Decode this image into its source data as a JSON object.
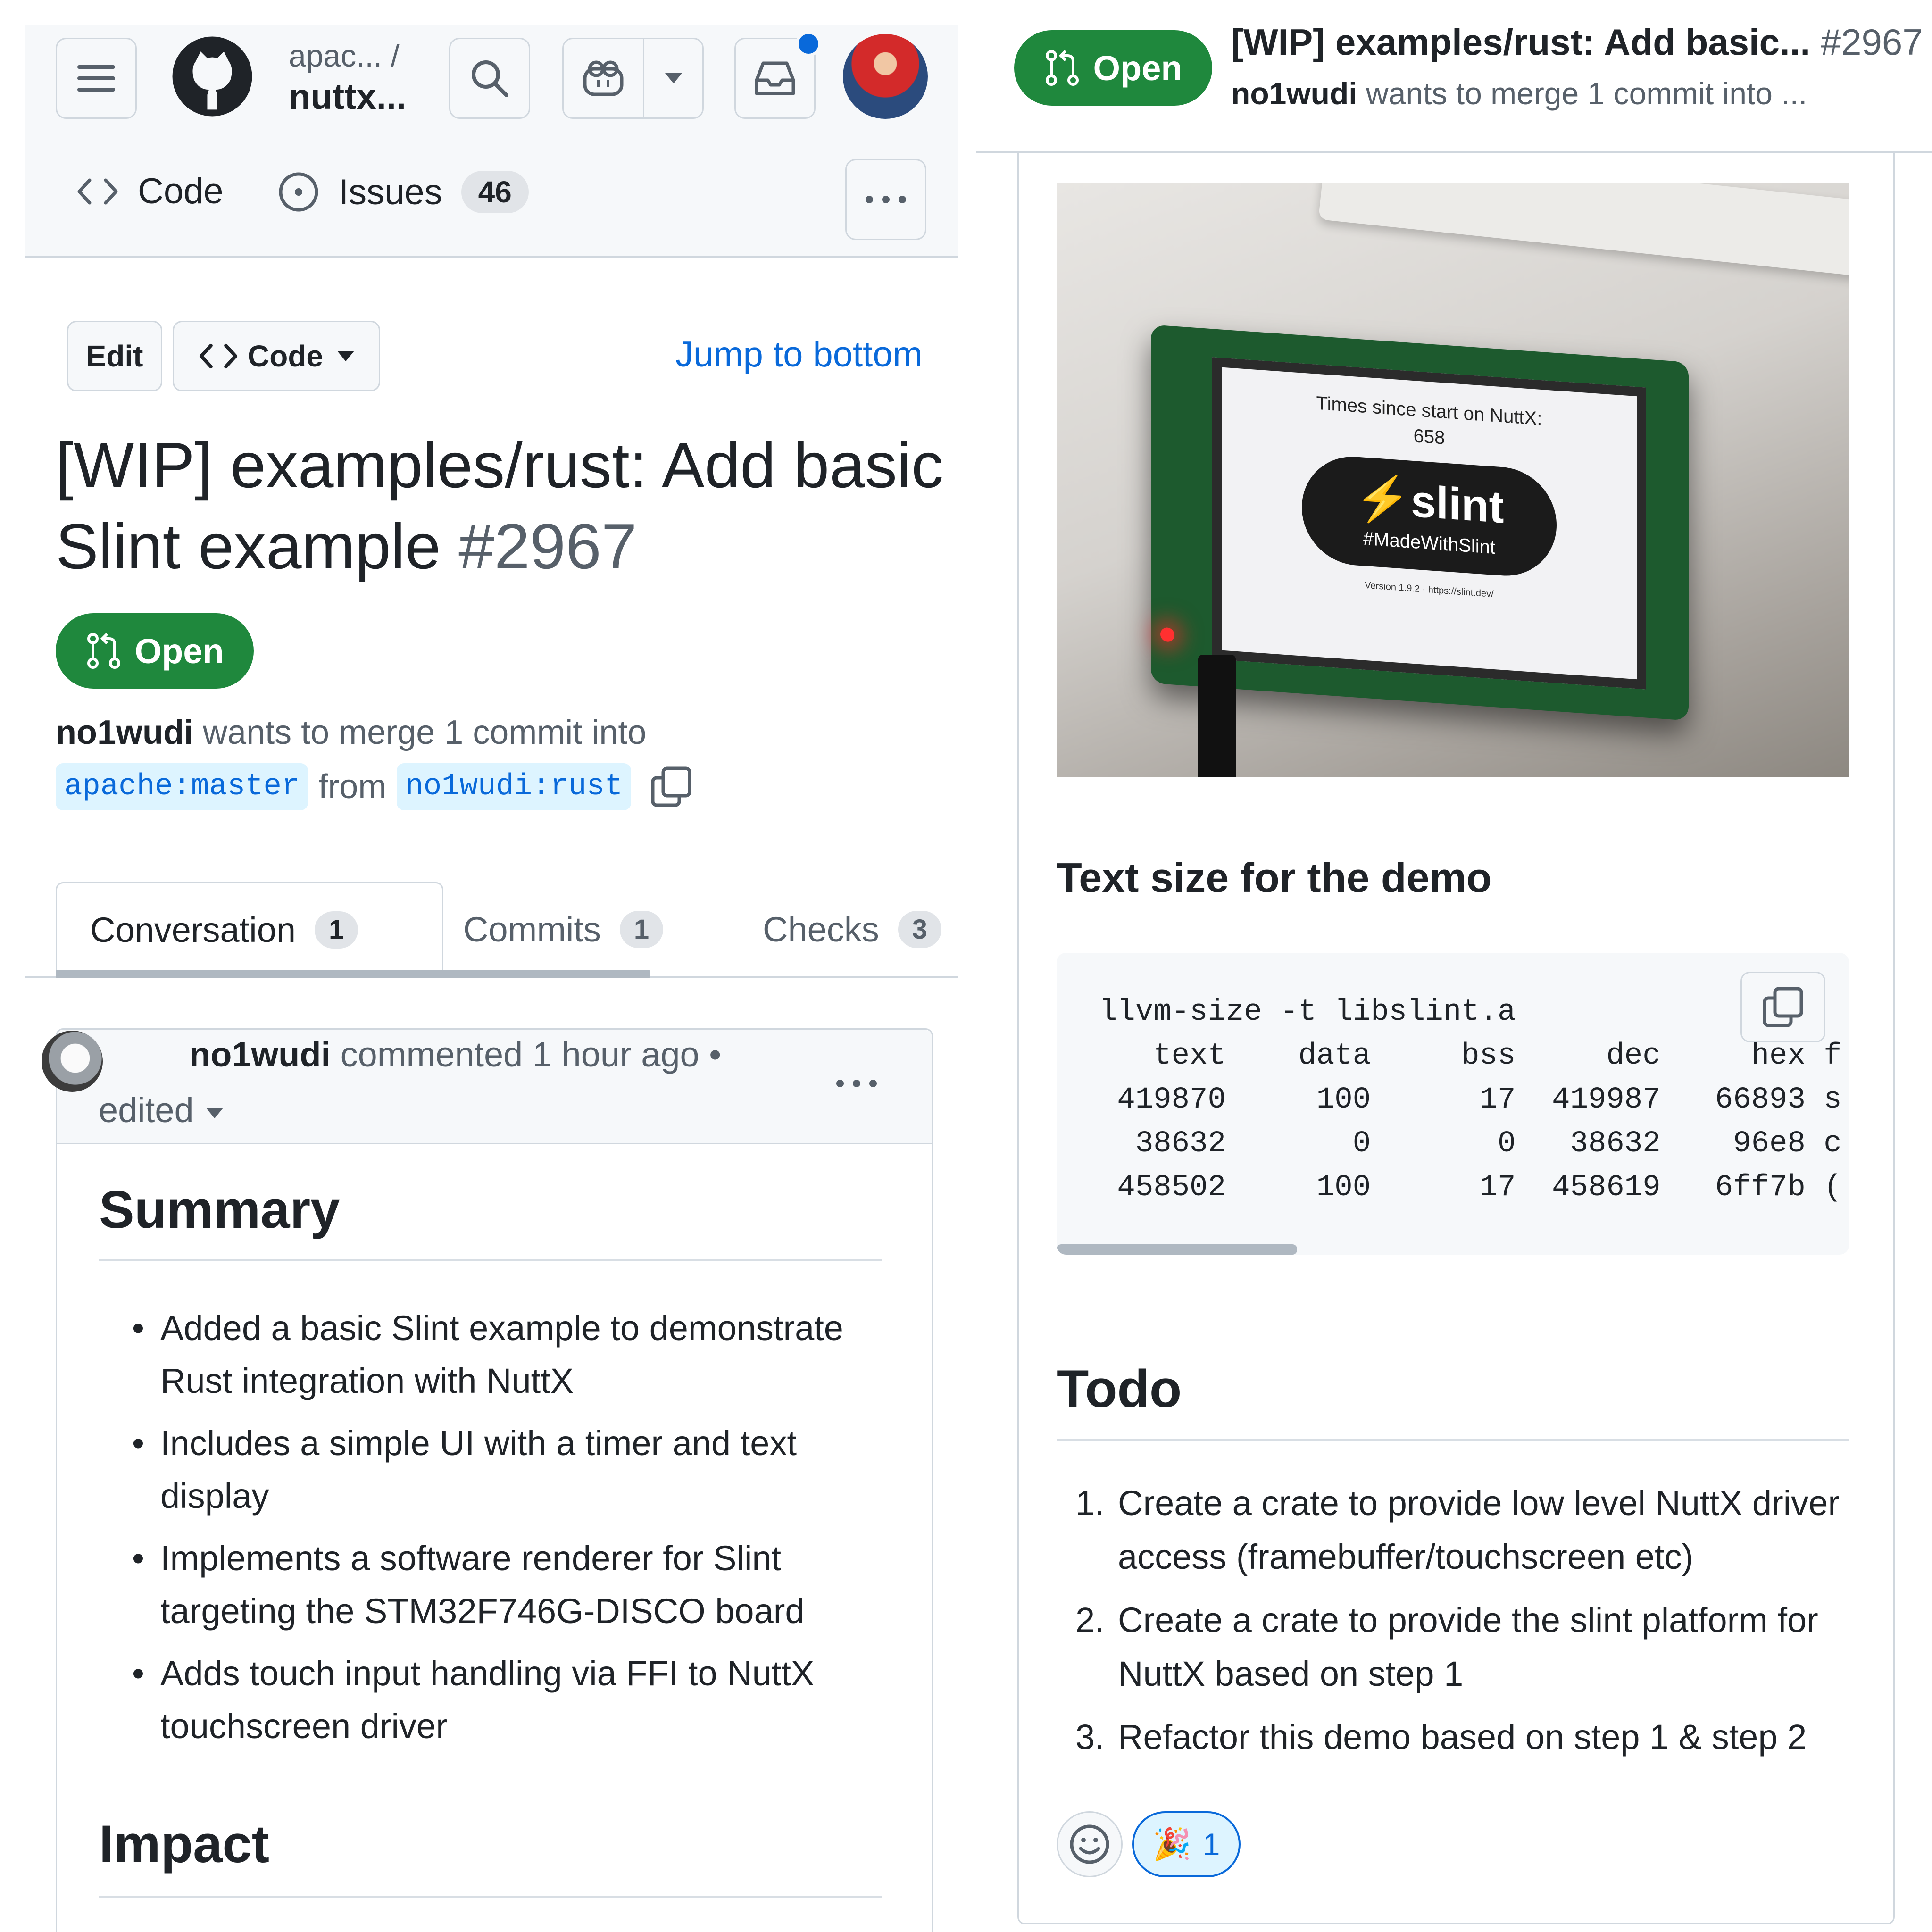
{
  "header": {
    "crumb_owner": "apac... /",
    "crumb_repo": "nuttx..."
  },
  "nav": {
    "code_label": "Code",
    "issues_label": "Issues",
    "issues_count": "46"
  },
  "actions": {
    "edit_label": "Edit",
    "code_label": "Code",
    "jump_label": "Jump to bottom"
  },
  "pr": {
    "title": "[WIP] examples/rust: Add basic Slint example",
    "number": "#2967",
    "short_title": "[WIP] examples/rust: Add basic...",
    "state": "Open",
    "author": "no1wudi",
    "merge_text": "wants to merge 1 commit into",
    "merge_text_short": "wants to merge 1 commit into ...",
    "base_branch": "apache:master",
    "from_text": "from",
    "head_branch": "no1wudi:rust"
  },
  "tabs": [
    {
      "label": "Conversation",
      "count": "1"
    },
    {
      "label": "Commits",
      "count": "1"
    },
    {
      "label": "Checks",
      "count": "3"
    }
  ],
  "comment": {
    "author": "no1wudi",
    "time_text": "commented 1 hour ago •",
    "edited_label": "edited",
    "summary_heading": "Summary",
    "summary_items": [
      "Added a basic Slint example to demonstrate Rust integration with NuttX",
      "Includes a simple UI with a timer and text display",
      "Implements a software renderer for Slint targeting the STM32F746G-DISCO board",
      "Adds touch input handling via FFI to NuttX touchscreen driver"
    ],
    "impact_heading": "Impact"
  },
  "photo": {
    "screen_line1": "Times since start on NuttX:",
    "screen_line2": "658",
    "logo_text": "slint",
    "hashtag": "#MadeWithSlint",
    "version_text": "Version 1.9.2 · https://slint.dev/"
  },
  "text_size": {
    "heading": "Text size for the demo",
    "code": "llvm-size -t libslint.a\n   text    data     bss     dec     hex f\n 419870     100      17  419987   66893 s\n  38632       0       0   38632    96e8 c\n 458502     100      17  458619   6ff7b ("
  },
  "todo": {
    "heading": "Todo",
    "items": [
      {
        "n": "1.",
        "text": "Create a crate to provide low level NuttX driver access (framebuffer/touchscreen etc)"
      },
      {
        "n": "2.",
        "text": "Create a crate to provide the slint platform for NuttX based on step 1"
      },
      {
        "n": "3.",
        "text": "Refactor this demo based on step 1 & step 2"
      }
    ]
  },
  "reactions": {
    "emoji": "🎉",
    "count": "1"
  },
  "colors": {
    "open_green": "#1f883d",
    "link_blue": "#0969da",
    "border": "#d0d7de"
  }
}
